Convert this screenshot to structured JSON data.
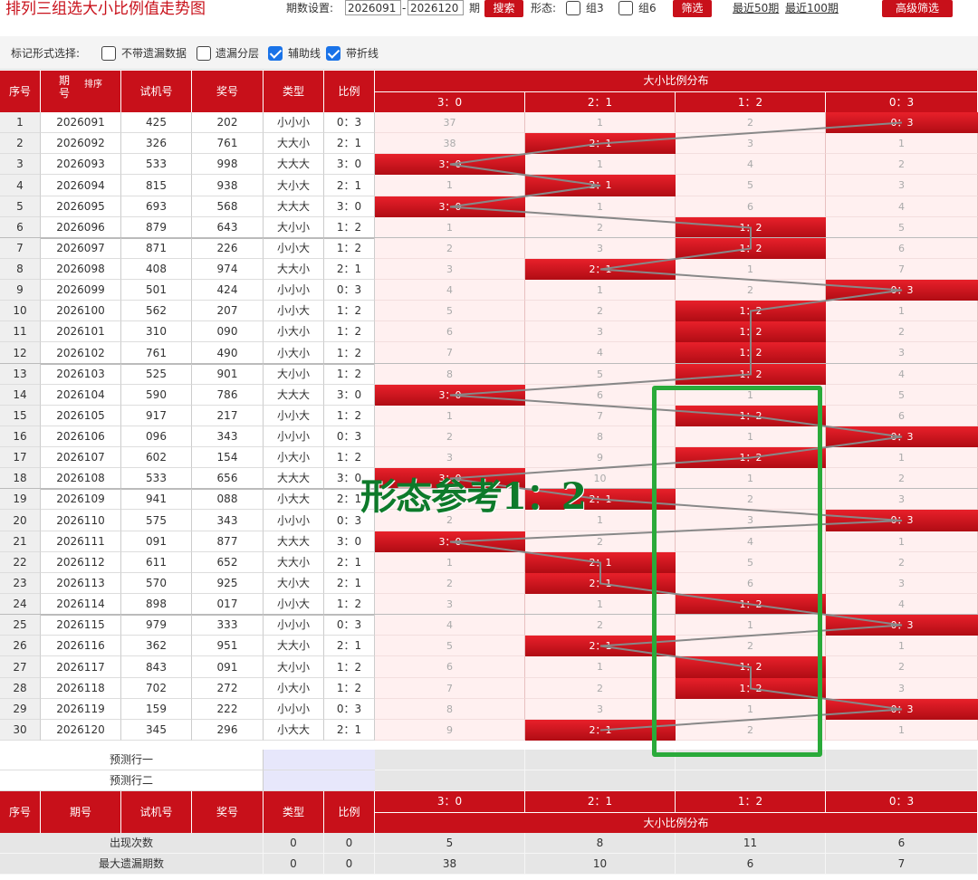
{
  "top": {
    "title": "排列三组选大小比例值走势图",
    "period_label": "期数设置:",
    "start": "2026091",
    "dash": "-",
    "end": "2026120",
    "period_unit": "期",
    "search_btn": "搜索",
    "form_label": "形态:",
    "group3": "组3",
    "group6": "组6",
    "filter_btn": "筛选",
    "recent50": "最近50期",
    "recent100": "最近100期",
    "adv_filter": "高级筛选"
  },
  "mark": {
    "label": "标记形式选择:",
    "opt1": "不带遗漏数据",
    "opt2": "遗漏分层",
    "opt3": "辅助线",
    "opt4": "带折线",
    "opt1_checked": false,
    "opt2_checked": false,
    "opt3_checked": true,
    "opt4_checked": true
  },
  "header": {
    "seq": "序号",
    "period": "期号",
    "sort": "排序",
    "test": "试机号",
    "award": "奖号",
    "type": "类型",
    "ratio": "比例",
    "dist": "大小比例分布",
    "cols": [
      "3：0",
      "2：1",
      "1：2",
      "0：3"
    ]
  },
  "rows": [
    {
      "seq": "1",
      "period": "2026091",
      "test": "425",
      "award": "202",
      "type": "小小小",
      "ratio": "0：3",
      "dist": [
        "37",
        "1",
        "2",
        "0：3"
      ],
      "hit": 3
    },
    {
      "seq": "2",
      "period": "2026092",
      "test": "326",
      "award": "761",
      "type": "大大小",
      "ratio": "2：1",
      "dist": [
        "38",
        "2：1",
        "3",
        "1"
      ],
      "hit": 1
    },
    {
      "seq": "3",
      "period": "2026093",
      "test": "533",
      "award": "998",
      "type": "大大大",
      "ratio": "3：0",
      "dist": [
        "3：0",
        "1",
        "4",
        "2"
      ],
      "hit": 0
    },
    {
      "seq": "4",
      "period": "2026094",
      "test": "815",
      "award": "938",
      "type": "大小大",
      "ratio": "2：1",
      "dist": [
        "1",
        "2：1",
        "5",
        "3"
      ],
      "hit": 1
    },
    {
      "seq": "5",
      "period": "2026095",
      "test": "693",
      "award": "568",
      "type": "大大大",
      "ratio": "3：0",
      "dist": [
        "3：0",
        "1",
        "6",
        "4"
      ],
      "hit": 0
    },
    {
      "seq": "6",
      "period": "2026096",
      "test": "879",
      "award": "643",
      "type": "大小小",
      "ratio": "1：2",
      "dist": [
        "1",
        "2",
        "1：2",
        "5"
      ],
      "hit": 2
    },
    {
      "seq": "7",
      "period": "2026097",
      "test": "871",
      "award": "226",
      "type": "小小大",
      "ratio": "1：2",
      "dist": [
        "2",
        "3",
        "1：2",
        "6"
      ],
      "hit": 2
    },
    {
      "seq": "8",
      "period": "2026098",
      "test": "408",
      "award": "974",
      "type": "大大小",
      "ratio": "2：1",
      "dist": [
        "3",
        "2：1",
        "1",
        "7"
      ],
      "hit": 1
    },
    {
      "seq": "9",
      "period": "2026099",
      "test": "501",
      "award": "424",
      "type": "小小小",
      "ratio": "0：3",
      "dist": [
        "4",
        "1",
        "2",
        "0：3"
      ],
      "hit": 3
    },
    {
      "seq": "10",
      "period": "2026100",
      "test": "562",
      "award": "207",
      "type": "小小大",
      "ratio": "1：2",
      "dist": [
        "5",
        "2",
        "1：2",
        "1"
      ],
      "hit": 2
    },
    {
      "seq": "11",
      "period": "2026101",
      "test": "310",
      "award": "090",
      "type": "小大小",
      "ratio": "1：2",
      "dist": [
        "6",
        "3",
        "1：2",
        "2"
      ],
      "hit": 2
    },
    {
      "seq": "12",
      "period": "2026102",
      "test": "761",
      "award": "490",
      "type": "小大小",
      "ratio": "1：2",
      "dist": [
        "7",
        "4",
        "1：2",
        "3"
      ],
      "hit": 2
    },
    {
      "seq": "13",
      "period": "2026103",
      "test": "525",
      "award": "901",
      "type": "大小小",
      "ratio": "1：2",
      "dist": [
        "8",
        "5",
        "1：2",
        "4"
      ],
      "hit": 2
    },
    {
      "seq": "14",
      "period": "2026104",
      "test": "590",
      "award": "786",
      "type": "大大大",
      "ratio": "3：0",
      "dist": [
        "3：0",
        "6",
        "1",
        "5"
      ],
      "hit": 0
    },
    {
      "seq": "15",
      "period": "2026105",
      "test": "917",
      "award": "217",
      "type": "小小大",
      "ratio": "1：2",
      "dist": [
        "1",
        "7",
        "1：2",
        "6"
      ],
      "hit": 2
    },
    {
      "seq": "16",
      "period": "2026106",
      "test": "096",
      "award": "343",
      "type": "小小小",
      "ratio": "0：3",
      "dist": [
        "2",
        "8",
        "1",
        "0：3"
      ],
      "hit": 3
    },
    {
      "seq": "17",
      "period": "2026107",
      "test": "602",
      "award": "154",
      "type": "小大小",
      "ratio": "1：2",
      "dist": [
        "3",
        "9",
        "1：2",
        "1"
      ],
      "hit": 2
    },
    {
      "seq": "18",
      "period": "2026108",
      "test": "533",
      "award": "656",
      "type": "大大大",
      "ratio": "3：0",
      "dist": [
        "3：0",
        "10",
        "1",
        "2"
      ],
      "hit": 0
    },
    {
      "seq": "19",
      "period": "2026109",
      "test": "941",
      "award": "088",
      "type": "小大大",
      "ratio": "2：1",
      "dist": [
        "1",
        "2：1",
        "2",
        "3"
      ],
      "hit": 1
    },
    {
      "seq": "20",
      "period": "2026110",
      "test": "575",
      "award": "343",
      "type": "小小小",
      "ratio": "0：3",
      "dist": [
        "2",
        "1",
        "3",
        "0：3"
      ],
      "hit": 3
    },
    {
      "seq": "21",
      "period": "2026111",
      "test": "091",
      "award": "877",
      "type": "大大大",
      "ratio": "3：0",
      "dist": [
        "3：0",
        "2",
        "4",
        "1"
      ],
      "hit": 0
    },
    {
      "seq": "22",
      "period": "2026112",
      "test": "611",
      "award": "652",
      "type": "大大小",
      "ratio": "2：1",
      "dist": [
        "1",
        "2：1",
        "5",
        "2"
      ],
      "hit": 1
    },
    {
      "seq": "23",
      "period": "2026113",
      "test": "570",
      "award": "925",
      "type": "大小大",
      "ratio": "2：1",
      "dist": [
        "2",
        "2：1",
        "6",
        "3"
      ],
      "hit": 1
    },
    {
      "seq": "24",
      "period": "2026114",
      "test": "898",
      "award": "017",
      "type": "小小大",
      "ratio": "1：2",
      "dist": [
        "3",
        "1",
        "1：2",
        "4"
      ],
      "hit": 2
    },
    {
      "seq": "25",
      "period": "2026115",
      "test": "979",
      "award": "333",
      "type": "小小小",
      "ratio": "0：3",
      "dist": [
        "4",
        "2",
        "1",
        "0：3"
      ],
      "hit": 3
    },
    {
      "seq": "26",
      "period": "2026116",
      "test": "362",
      "award": "951",
      "type": "大大小",
      "ratio": "2：1",
      "dist": [
        "5",
        "2：1",
        "2",
        "1"
      ],
      "hit": 1
    },
    {
      "seq": "27",
      "period": "2026117",
      "test": "843",
      "award": "091",
      "type": "大小小",
      "ratio": "1：2",
      "dist": [
        "6",
        "1",
        "1：2",
        "2"
      ],
      "hit": 2
    },
    {
      "seq": "28",
      "period": "2026118",
      "test": "702",
      "award": "272",
      "type": "小大小",
      "ratio": "1：2",
      "dist": [
        "7",
        "2",
        "1：2",
        "3"
      ],
      "hit": 2
    },
    {
      "seq": "29",
      "period": "2026119",
      "test": "159",
      "award": "222",
      "type": "小小小",
      "ratio": "0：3",
      "dist": [
        "8",
        "3",
        "1",
        "0：3"
      ],
      "hit": 3
    },
    {
      "seq": "30",
      "period": "2026120",
      "test": "345",
      "award": "296",
      "type": "小大大",
      "ratio": "2：1",
      "dist": [
        "9",
        "2：1",
        "2",
        "1"
      ],
      "hit": 1
    }
  ],
  "predict": {
    "row1": "预测行一",
    "row2": "预测行二"
  },
  "stats": [
    {
      "label": "出现次数",
      "type": "0",
      "ratio": "0",
      "vals": [
        "5",
        "8",
        "11",
        "6"
      ]
    },
    {
      "label": "最大遗漏期数",
      "type": "0",
      "ratio": "0",
      "vals": [
        "38",
        "10",
        "6",
        "7"
      ]
    }
  ],
  "annotation": {
    "text": "形态参考1：2"
  }
}
